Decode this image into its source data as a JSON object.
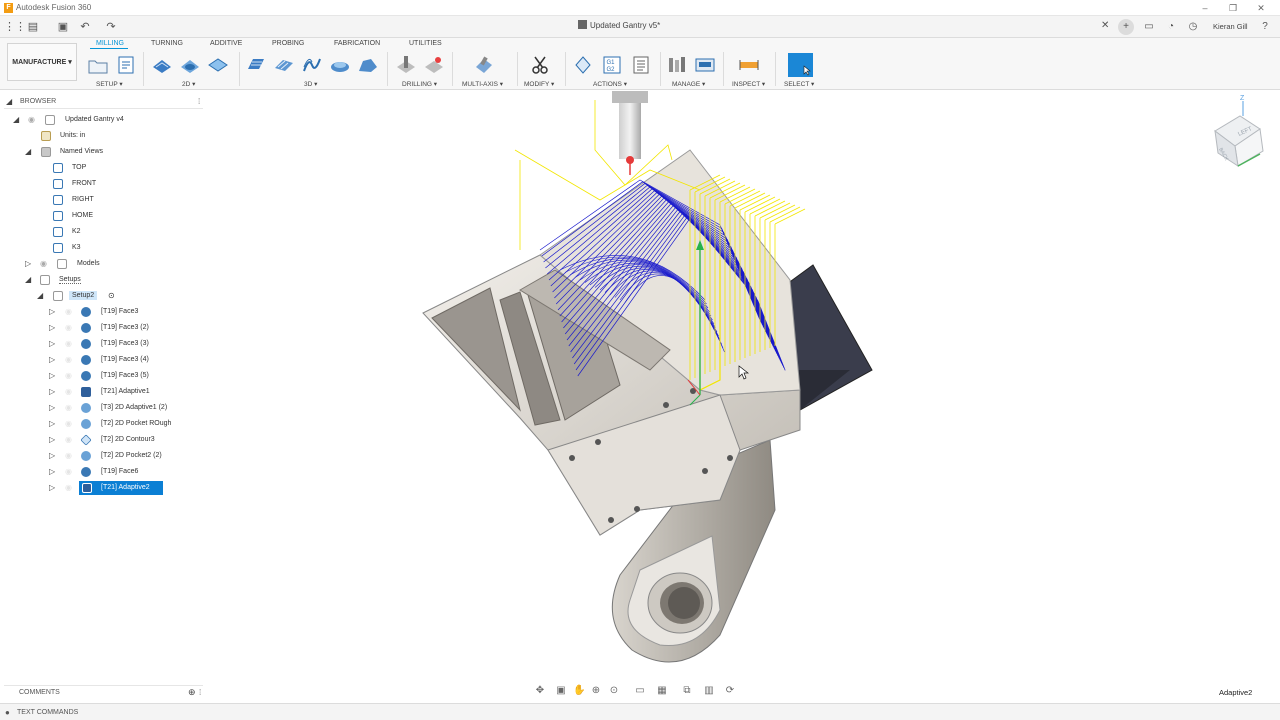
{
  "window": {
    "app_title": "Autodesk Fusion 360"
  },
  "tabbar": {
    "document_tab": "Updated Gantry v5*",
    "user_name": "Kieran Gill"
  },
  "workspace": {
    "label": "MANUFACTURE ▾"
  },
  "ribbon": {
    "tabs": [
      "MILLING",
      "TURNING",
      "ADDITIVE",
      "PROBING",
      "FABRICATION",
      "UTILITIES"
    ],
    "active_tab": "MILLING",
    "groups": [
      "SETUP ▾",
      "2D ▾",
      "3D ▾",
      "DRILLING ▾",
      "MULTI-AXIS ▾",
      "MODIFY ▾",
      "ACTIONS ▾",
      "MANAGE ▾",
      "INSPECT ▾",
      "SELECT ▾"
    ]
  },
  "browser": {
    "title": "BROWSER",
    "root": "Updated Gantry v4",
    "units": "Units: in",
    "named_views": "Named Views",
    "views": [
      "TOP",
      "FRONT",
      "RIGHT",
      "HOME",
      "K2",
      "K3"
    ],
    "models": "Models",
    "setups": "Setups",
    "setup": "Setup2",
    "operations": [
      "[T19] Face3",
      "[T19] Face3 (2)",
      "[T19] Face3 (3)",
      "[T19] Face3 (4)",
      "[T19] Face3 (5)",
      "[T21] Adaptive1",
      "[T3] 2D Adaptive1 (2)",
      "[T2] 2D Pocket ROugh",
      "[T2] 2D Contour3",
      "[T2] 2D Pocket2 (2)",
      "[T19] Face6",
      "[T21] Adaptive2"
    ],
    "selected_operation": "[T21] Adaptive2"
  },
  "viewcube": {
    "face_left": "LEFT",
    "face_front": "BACK",
    "axis_z": "Z"
  },
  "comments": {
    "label": "COMMENTS"
  },
  "text_commands": {
    "label": "TEXT COMMANDS"
  },
  "status": {
    "active_operation": "Adaptive2"
  },
  "colors": {
    "accent": "#0696d7",
    "selection": "#0b7fd4",
    "toolpath_blue": "#1a1acc",
    "toolpath_yellow": "#f2e600"
  }
}
